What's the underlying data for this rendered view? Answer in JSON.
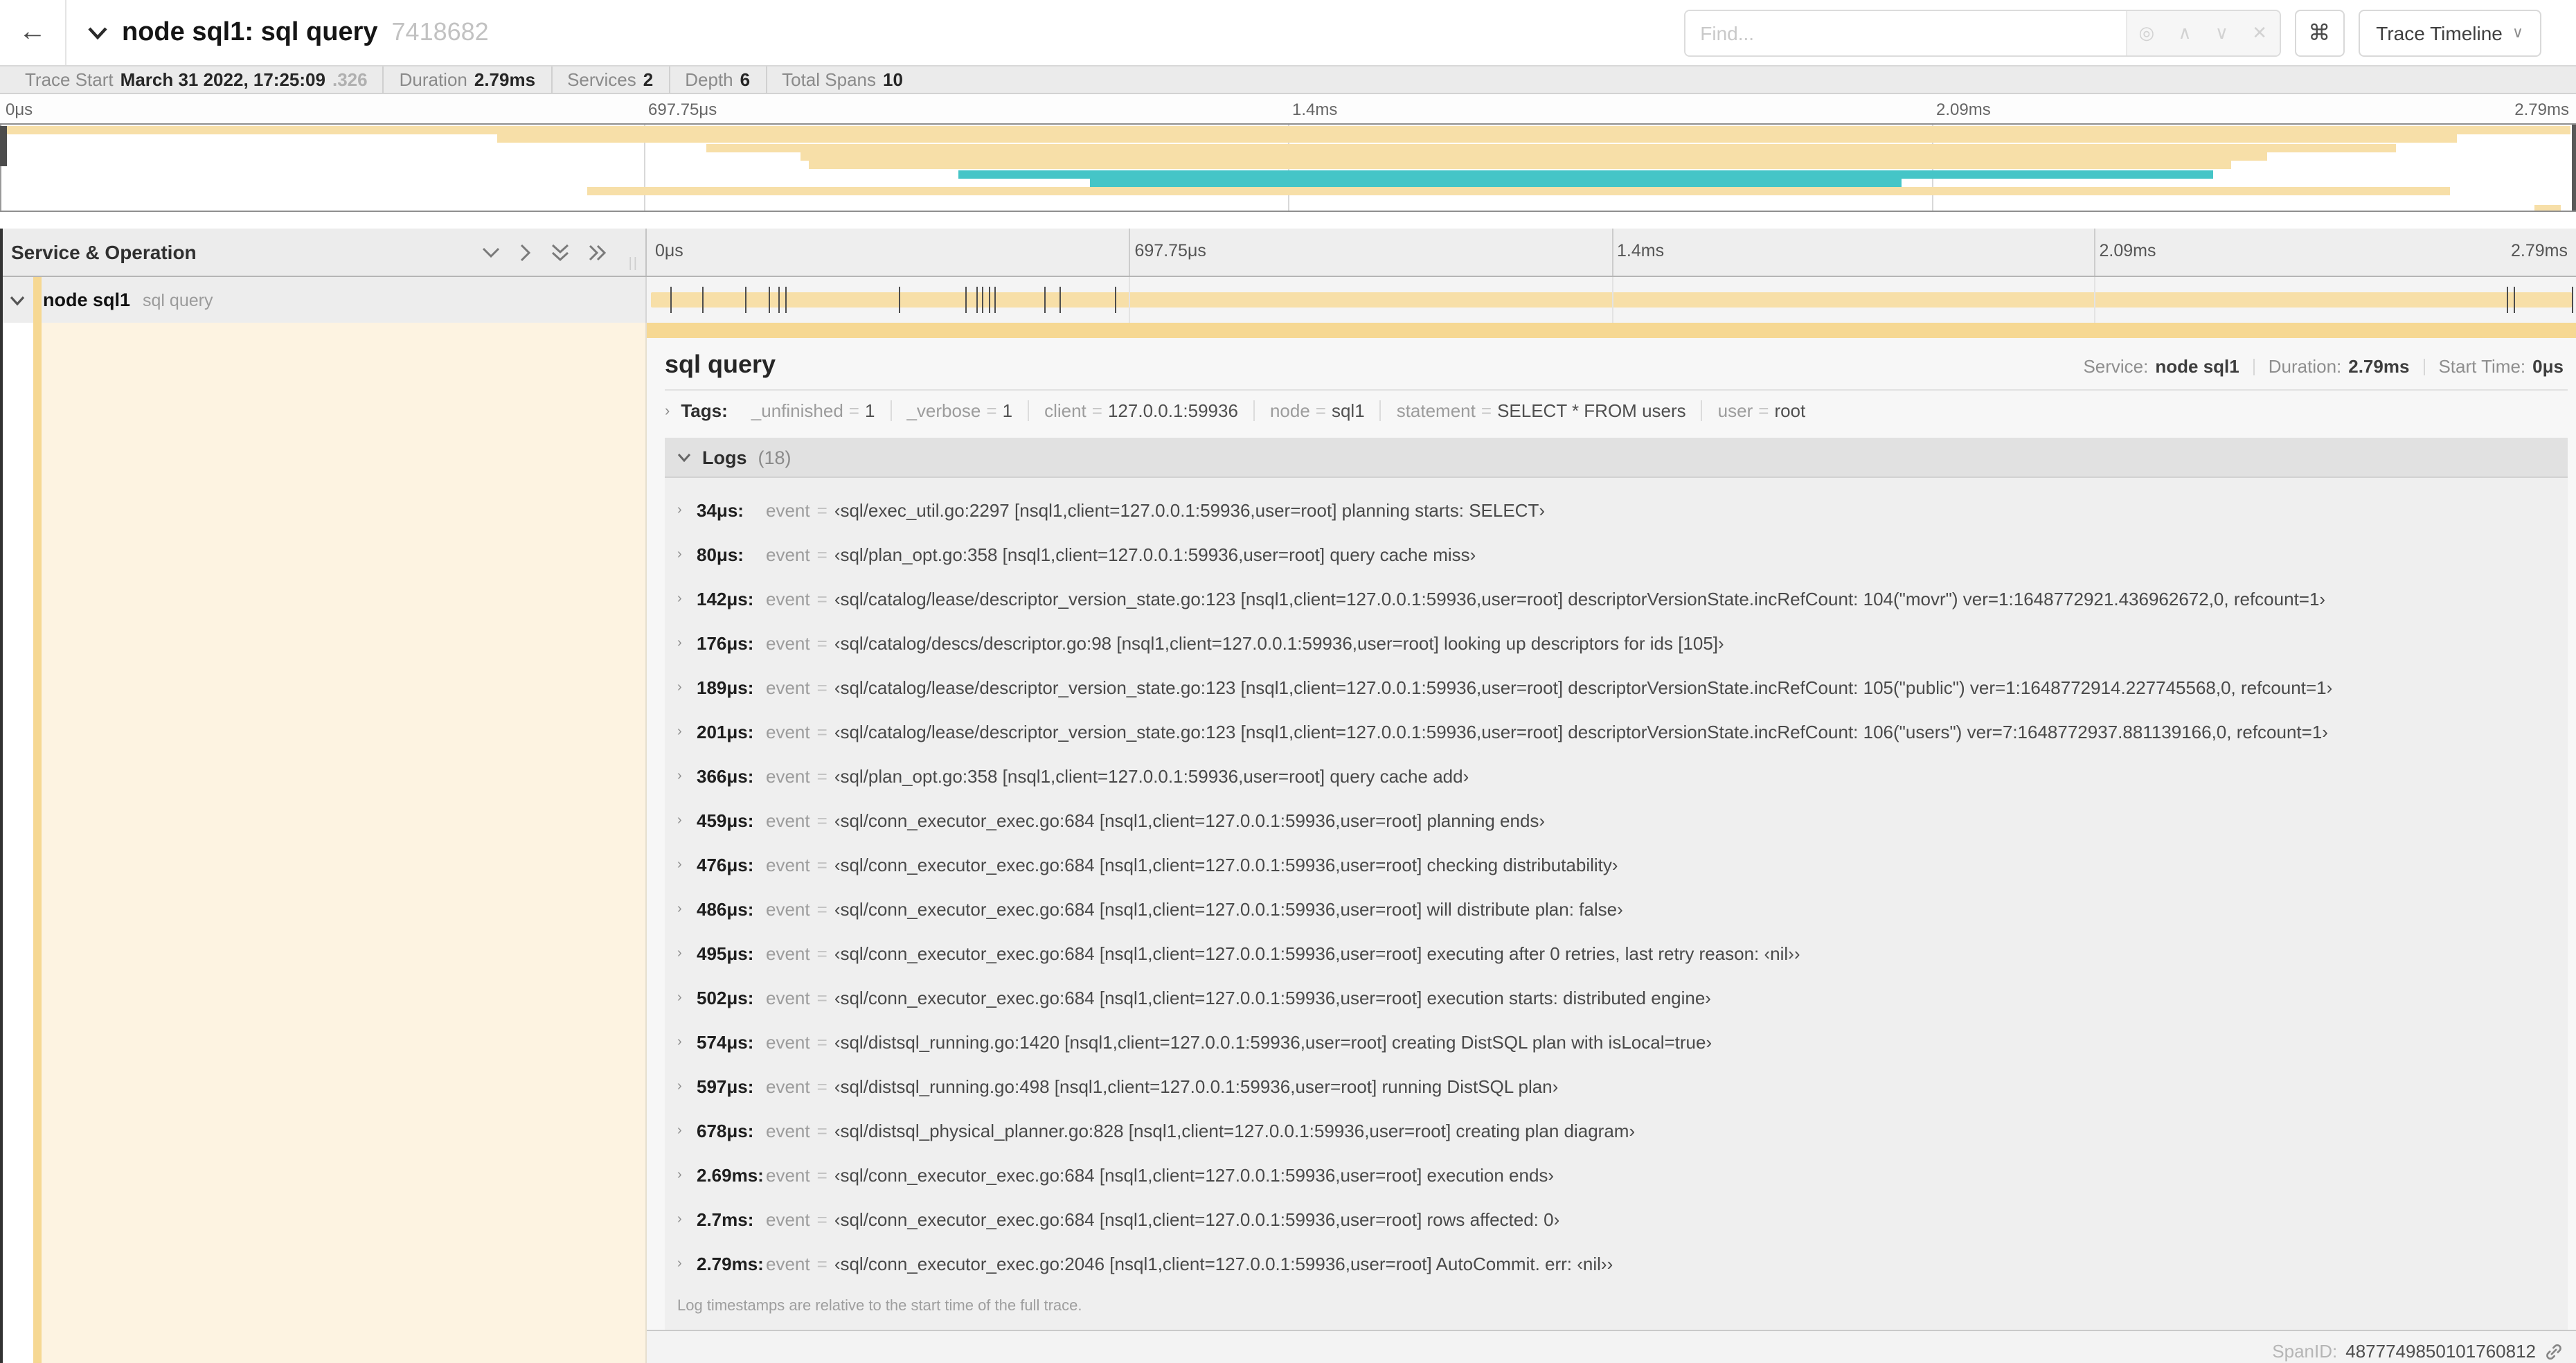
{
  "header": {
    "back_glyph": "←",
    "title": "node sql1: sql query",
    "trace_id": "7418682",
    "find_placeholder": "Find...",
    "find_icons": [
      "◎",
      "∧",
      "∨",
      "✕"
    ],
    "command_glyph": "⌘",
    "view_selector": "Trace Timeline"
  },
  "summary": {
    "items": [
      {
        "label": "Trace Start",
        "value": "March 31 2022, 17:25:09",
        "suffix": ".326"
      },
      {
        "label": "Duration",
        "value": "2.79ms",
        "suffix": ""
      },
      {
        "label": "Services",
        "value": "2",
        "suffix": ""
      },
      {
        "label": "Depth",
        "value": "6",
        "suffix": ""
      },
      {
        "label": "Total Spans",
        "value": "10",
        "suffix": ""
      }
    ]
  },
  "colors": {
    "khaki": "#F7DFA8",
    "khaki_accent": "#F6D893",
    "teal": "#45C5C7",
    "cream": "#FDF3E1"
  },
  "timeline": {
    "ticks": [
      "0μs",
      "697.75μs",
      "1.4ms",
      "2.09ms",
      "2.79ms"
    ],
    "minimap_bars": [
      {
        "row": 0,
        "start": 0,
        "end": 99.8,
        "color": "khaki"
      },
      {
        "row": 1,
        "start": 19.3,
        "end": 95.4,
        "color": "khaki"
      },
      {
        "row": 2,
        "start": 27.4,
        "end": 93.0,
        "color": "khaki"
      },
      {
        "row": 3,
        "start": 31.1,
        "end": 88.0,
        "color": "khaki"
      },
      {
        "row": 4,
        "start": 31.4,
        "end": 86.6,
        "color": "khaki"
      },
      {
        "row": 5,
        "start": 37.2,
        "end": 85.9,
        "color": "teal"
      },
      {
        "row": 6,
        "start": 42.3,
        "end": 73.8,
        "color": "teal"
      },
      {
        "row": 7,
        "start": 22.8,
        "end": 95.1,
        "color": "khaki"
      },
      {
        "row": 9,
        "start": 98.4,
        "end": 99.4,
        "color": "khaki"
      }
    ],
    "row_log_markers": [
      1.2,
      2.9,
      5.1,
      6.3,
      6.8,
      7.2,
      13.1,
      16.5,
      17.1,
      17.4,
      17.7,
      18.0,
      20.6,
      21.4,
      24.3,
      96.4,
      96.8,
      99.8
    ]
  },
  "span_list": {
    "header": "Service & Operation",
    "rows": [
      {
        "service": "node sql1",
        "operation": "sql query"
      }
    ]
  },
  "detail": {
    "operation": "sql query",
    "meta": [
      {
        "label": "Service:",
        "value": "node sql1"
      },
      {
        "label": "Duration:",
        "value": "2.79ms"
      },
      {
        "label": "Start Time:",
        "value": "0μs"
      }
    ],
    "tags_label": "Tags:",
    "tags": [
      {
        "key": "_unfinished",
        "value": "1"
      },
      {
        "key": "_verbose",
        "value": "1"
      },
      {
        "key": "client",
        "value": "127.0.0.1:59936"
      },
      {
        "key": "node",
        "value": "sql1"
      },
      {
        "key": "statement",
        "value": "SELECT * FROM users"
      },
      {
        "key": "user",
        "value": "root"
      }
    ],
    "logs_label": "Logs",
    "logs_count": "(18)",
    "log_field": "event",
    "logs": [
      {
        "time": "34μs:",
        "value": "‹sql/exec_util.go:2297 [nsql1,client=127.0.0.1:59936,user=root] planning starts: SELECT›"
      },
      {
        "time": "80μs:",
        "value": "‹sql/plan_opt.go:358 [nsql1,client=127.0.0.1:59936,user=root] query cache miss›"
      },
      {
        "time": "142μs:",
        "value": "‹sql/catalog/lease/descriptor_version_state.go:123 [nsql1,client=127.0.0.1:59936,user=root] descriptorVersionState.incRefCount: 104(\"movr\") ver=1:1648772921.436962672,0, refcount=1›"
      },
      {
        "time": "176μs:",
        "value": "‹sql/catalog/descs/descriptor.go:98 [nsql1,client=127.0.0.1:59936,user=root] looking up descriptors for ids [105]›"
      },
      {
        "time": "189μs:",
        "value": "‹sql/catalog/lease/descriptor_version_state.go:123 [nsql1,client=127.0.0.1:59936,user=root] descriptorVersionState.incRefCount: 105(\"public\") ver=1:1648772914.227745568,0, refcount=1›"
      },
      {
        "time": "201μs:",
        "value": "‹sql/catalog/lease/descriptor_version_state.go:123 [nsql1,client=127.0.0.1:59936,user=root] descriptorVersionState.incRefCount: 106(\"users\") ver=7:1648772937.881139166,0, refcount=1›"
      },
      {
        "time": "366μs:",
        "value": "‹sql/plan_opt.go:358 [nsql1,client=127.0.0.1:59936,user=root] query cache add›"
      },
      {
        "time": "459μs:",
        "value": "‹sql/conn_executor_exec.go:684 [nsql1,client=127.0.0.1:59936,user=root] planning ends›"
      },
      {
        "time": "476μs:",
        "value": "‹sql/conn_executor_exec.go:684 [nsql1,client=127.0.0.1:59936,user=root] checking distributability›"
      },
      {
        "time": "486μs:",
        "value": "‹sql/conn_executor_exec.go:684 [nsql1,client=127.0.0.1:59936,user=root] will distribute plan: false›"
      },
      {
        "time": "495μs:",
        "value": "‹sql/conn_executor_exec.go:684 [nsql1,client=127.0.0.1:59936,user=root] executing after 0 retries, last retry reason: ‹nil››"
      },
      {
        "time": "502μs:",
        "value": "‹sql/conn_executor_exec.go:684 [nsql1,client=127.0.0.1:59936,user=root] execution starts: distributed engine›"
      },
      {
        "time": "574μs:",
        "value": "‹sql/distsql_running.go:1420 [nsql1,client=127.0.0.1:59936,user=root] creating DistSQL plan with isLocal=true›"
      },
      {
        "time": "597μs:",
        "value": "‹sql/distsql_running.go:498 [nsql1,client=127.0.0.1:59936,user=root] running DistSQL plan›"
      },
      {
        "time": "678μs:",
        "value": "‹sql/distsql_physical_planner.go:828 [nsql1,client=127.0.0.1:59936,user=root] creating plan diagram›"
      },
      {
        "time": "2.69ms:",
        "value": "‹sql/conn_executor_exec.go:684 [nsql1,client=127.0.0.1:59936,user=root] execution ends›"
      },
      {
        "time": "2.7ms:",
        "value": "‹sql/conn_executor_exec.go:684 [nsql1,client=127.0.0.1:59936,user=root] rows affected: 0›"
      },
      {
        "time": "2.79ms:",
        "value": "‹sql/conn_executor_exec.go:2046 [nsql1,client=127.0.0.1:59936,user=root] AutoCommit. err: ‹nil››"
      }
    ],
    "logs_note": "Log timestamps are relative to the start time of the full trace.",
    "spanid_label": "SpanID:",
    "spanid_value": "4877749850101760812"
  }
}
